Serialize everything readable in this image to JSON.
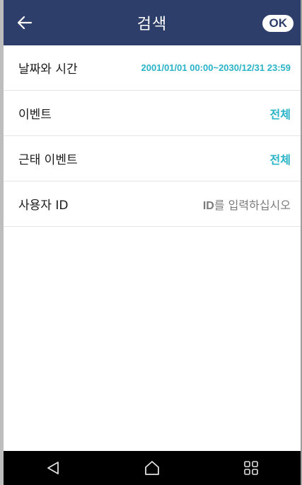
{
  "header": {
    "title": "검색",
    "ok_label": "OK",
    "back_icon": "arrow-left-icon"
  },
  "rows": [
    {
      "label": "날짜와 시간",
      "value": "2001/01/01 00:00~2030/12/31 23:59"
    },
    {
      "label": "이벤트",
      "value": "전체"
    },
    {
      "label": "근태 이벤트",
      "value": "전체"
    },
    {
      "label": "사용자 ID",
      "placeholder_strong": "ID",
      "placeholder_rest": "를 입력하십시오"
    }
  ],
  "navbar": {
    "icons": [
      "back-triangle-icon",
      "home-icon",
      "recent-apps-icon"
    ]
  },
  "colors": {
    "header_bg": "#2e3e6a",
    "accent": "#29b3c8",
    "navbar_bg": "#000000"
  }
}
